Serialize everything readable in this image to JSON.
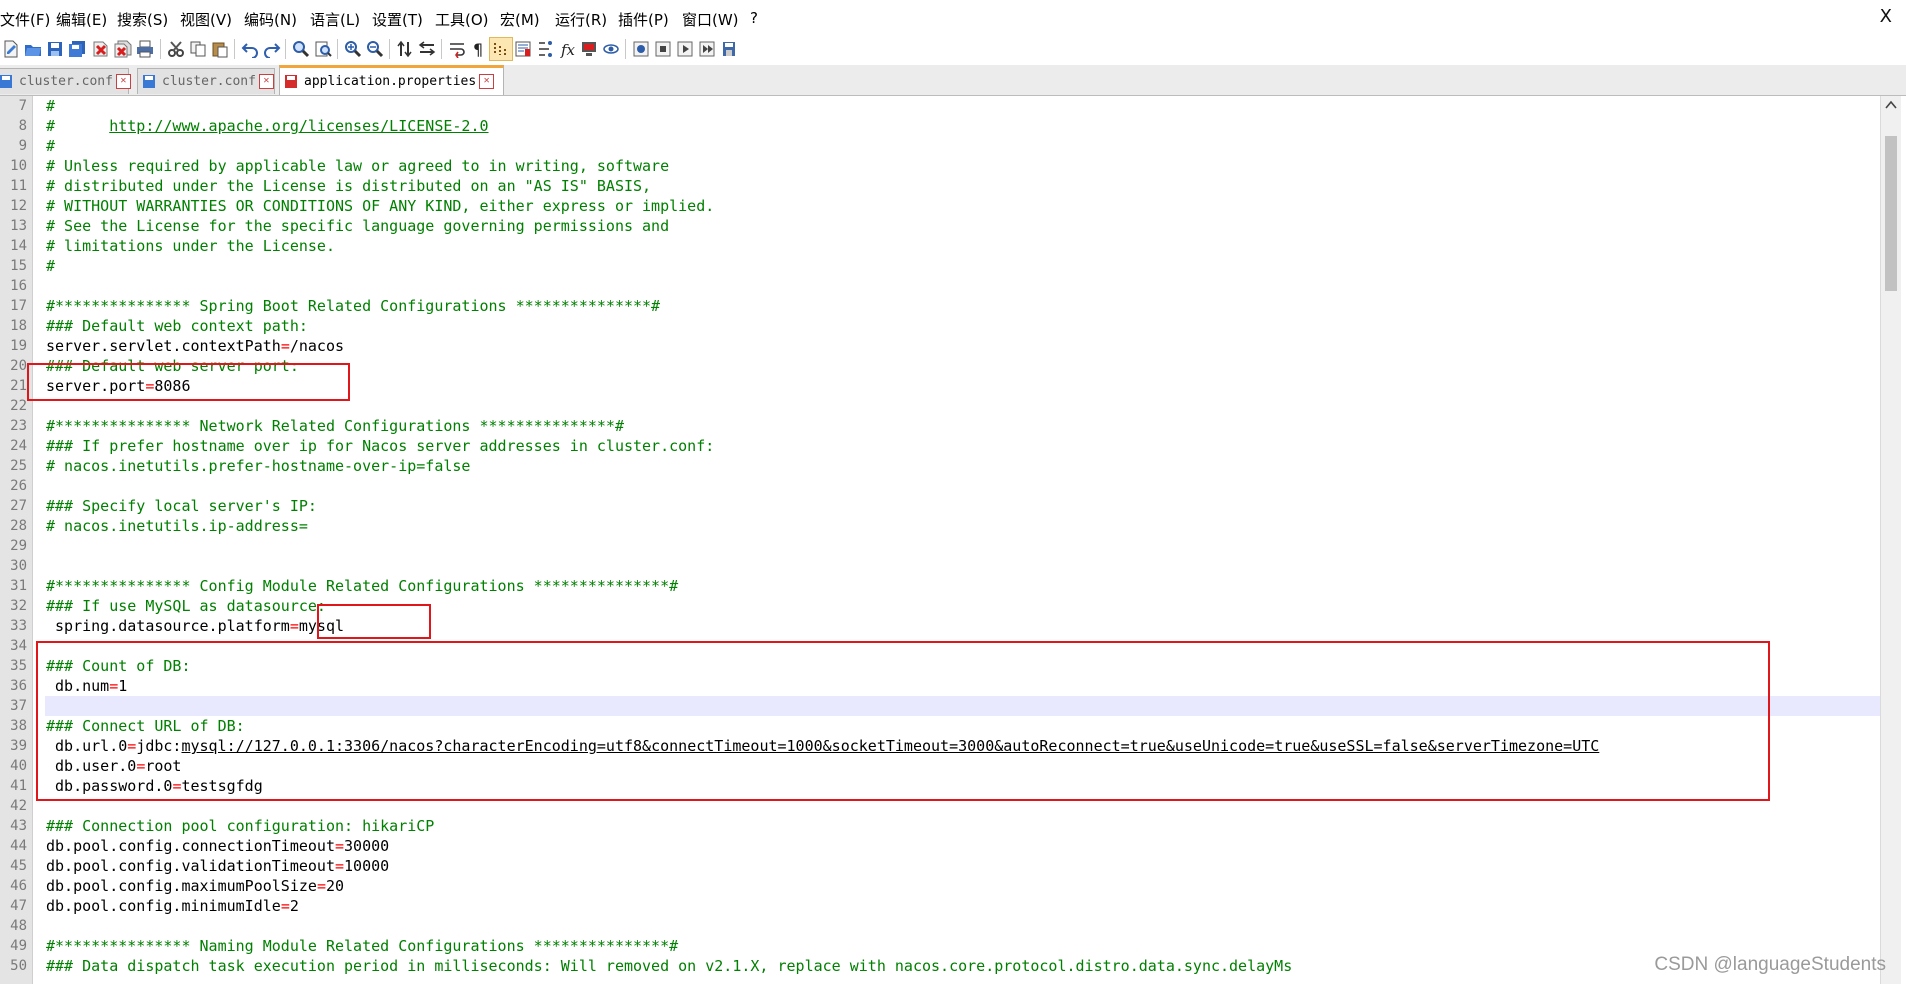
{
  "menu": {
    "items": [
      "文件(F)",
      "编辑(E)",
      "搜索(S)",
      "视图(V)",
      "编码(N)",
      "语言(L)",
      "设置(T)",
      "工具(O)",
      "宏(M)",
      "运行(R)",
      "插件(P)",
      "窗口(W)",
      "?"
    ],
    "close_label": "X"
  },
  "toolbar": {
    "icons": [
      "new-file-icon",
      "open-file-icon",
      "save-icon",
      "save-all-icon",
      "close-icon",
      "close-all-icon",
      "print-icon",
      "cut-icon",
      "copy-icon",
      "paste-icon",
      "undo-icon",
      "redo-icon",
      "find-icon",
      "replace-icon",
      "zoom-in-icon",
      "zoom-out-icon",
      "sync-vertical-icon",
      "sync-horizontal-icon",
      "word-wrap-icon",
      "show-all-chars-icon",
      "indent-guide-icon",
      "doc-map-icon",
      "function-list-icon",
      "folder-workspace-icon",
      "monitor-icon",
      "record-macro-icon",
      "stop-record-icon",
      "play-macro-icon",
      "run-macro-multiple-icon",
      "save-macro-icon"
    ]
  },
  "tabs": [
    {
      "label": "cluster.conf",
      "active": false
    },
    {
      "label": "cluster.conf",
      "active": false
    },
    {
      "label": "application.properties",
      "active": true
    }
  ],
  "editor": {
    "current_line": 37,
    "lines": [
      {
        "n": "7",
        "type": "comment",
        "text": "#"
      },
      {
        "n": "8",
        "type": "comment-link",
        "text": "#      ",
        "link": "http://www.apache.org/licenses/LICENSE-2.0"
      },
      {
        "n": "9",
        "type": "comment",
        "text": "#"
      },
      {
        "n": "10",
        "type": "comment",
        "text": "# Unless required by applicable law or agreed to in writing, software"
      },
      {
        "n": "11",
        "type": "comment",
        "text": "# distributed under the License is distributed on an \"AS IS\" BASIS,"
      },
      {
        "n": "12",
        "type": "comment",
        "text": "# WITHOUT WARRANTIES OR CONDITIONS OF ANY KIND, either express or implied."
      },
      {
        "n": "13",
        "type": "comment",
        "text": "# See the License for the specific language governing permissions and"
      },
      {
        "n": "14",
        "type": "comment",
        "text": "# limitations under the License."
      },
      {
        "n": "15",
        "type": "comment",
        "text": "#"
      },
      {
        "n": "16",
        "type": "blank",
        "text": ""
      },
      {
        "n": "17",
        "type": "comment",
        "text": "#*************** Spring Boot Related Configurations ***************#"
      },
      {
        "n": "18",
        "type": "comment",
        "text": "### Default web context path:"
      },
      {
        "n": "19",
        "type": "kv",
        "key": "server.servlet.contextPath",
        "op": "=",
        "value": "/nacos"
      },
      {
        "n": "20",
        "type": "comment",
        "text": "### Default web server port:"
      },
      {
        "n": "21",
        "type": "kv",
        "key": "server.port",
        "op": "=",
        "value": "8086"
      },
      {
        "n": "22",
        "type": "blank",
        "text": ""
      },
      {
        "n": "23",
        "type": "comment",
        "text": "#*************** Network Related Configurations ***************#"
      },
      {
        "n": "24",
        "type": "comment",
        "text": "### If prefer hostname over ip for Nacos server addresses in cluster.conf:"
      },
      {
        "n": "25",
        "type": "comment",
        "text": "# nacos.inetutils.prefer-hostname-over-ip=false"
      },
      {
        "n": "26",
        "type": "blank",
        "text": ""
      },
      {
        "n": "27",
        "type": "comment",
        "text": "### Specify local server's IP:"
      },
      {
        "n": "28",
        "type": "comment",
        "text": "# nacos.inetutils.ip-address="
      },
      {
        "n": "29",
        "type": "blank",
        "text": ""
      },
      {
        "n": "30",
        "type": "blank",
        "text": ""
      },
      {
        "n": "31",
        "type": "comment",
        "text": "#*************** Config Module Related Configurations ***************#"
      },
      {
        "n": "32",
        "type": "comment",
        "text": "### If use MySQL as datasource:"
      },
      {
        "n": "33",
        "type": "kv",
        "key": " spring.datasource.platform",
        "op": "=",
        "value": "mysql"
      },
      {
        "n": "34",
        "type": "blank",
        "text": ""
      },
      {
        "n": "35",
        "type": "comment",
        "text": "### Count of DB:"
      },
      {
        "n": "36",
        "type": "kv",
        "key": " db.num",
        "op": "=",
        "value": "1"
      },
      {
        "n": "37",
        "type": "blank",
        "text": ""
      },
      {
        "n": "38",
        "type": "comment",
        "text": "### Connect URL of DB:"
      },
      {
        "n": "39",
        "type": "kv-url",
        "key": " db.url.0",
        "op": "=",
        "prefix": "jdbc:",
        "url": "mysql://127.0.0.1:3306/nacos?characterEncoding=utf8&connectTimeout=1000&socketTimeout=3000&autoReconnect=true&useUnicode=true&useSSL=false&serverTimezone=UTC"
      },
      {
        "n": "40",
        "type": "kv",
        "key": " db.user.0",
        "op": "=",
        "value": "root"
      },
      {
        "n": "41",
        "type": "kv",
        "key": " db.password.0",
        "op": "=",
        "value": "testsgfdg"
      },
      {
        "n": "42",
        "type": "blank",
        "text": ""
      },
      {
        "n": "43",
        "type": "comment",
        "text": "### Connection pool configuration: hikariCP"
      },
      {
        "n": "44",
        "type": "kv",
        "key": "db.pool.config.connectionTimeout",
        "op": "=",
        "value": "30000"
      },
      {
        "n": "45",
        "type": "kv",
        "key": "db.pool.config.validationTimeout",
        "op": "=",
        "value": "10000"
      },
      {
        "n": "46",
        "type": "kv",
        "key": "db.pool.config.maximumPoolSize",
        "op": "=",
        "value": "20"
      },
      {
        "n": "47",
        "type": "kv",
        "key": "db.pool.config.minimumIdle",
        "op": "=",
        "value": "2"
      },
      {
        "n": "48",
        "type": "blank",
        "text": ""
      },
      {
        "n": "49",
        "type": "comment",
        "text": "#*************** Naming Module Related Configurations ***************#"
      },
      {
        "n": "50",
        "type": "comment",
        "text": "### Data dispatch task execution period in milliseconds: Will removed on v2.1.X, replace with nacos.core.protocol.distro.data.sync.delayMs"
      }
    ]
  },
  "watermark": "CSDN @languageStudents"
}
